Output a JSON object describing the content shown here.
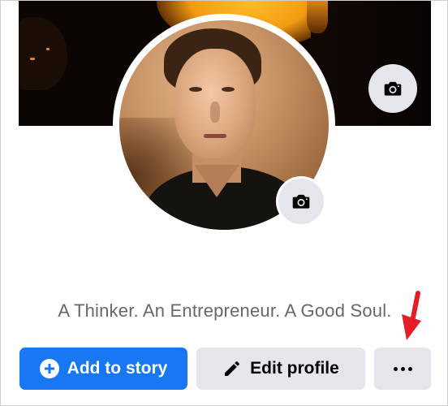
{
  "profile": {
    "bio": "A Thinker. An Entrepreneur. A Good Soul.",
    "cover_camera_icon": "camera-icon",
    "avatar_camera_icon": "camera-icon"
  },
  "actions": {
    "add_to_story_label": "Add to story",
    "add_to_story_icon": "plus-circle-icon",
    "edit_profile_label": "Edit profile",
    "edit_profile_icon": "pencil-icon",
    "more_icon": "more-dots-icon"
  },
  "annotation": {
    "icon": "red-arrow-icon",
    "color": "#e41e26"
  },
  "colors": {
    "primary": "#1877f2",
    "secondary_button": "#e4e6eb",
    "muted_text": "#65676b"
  }
}
